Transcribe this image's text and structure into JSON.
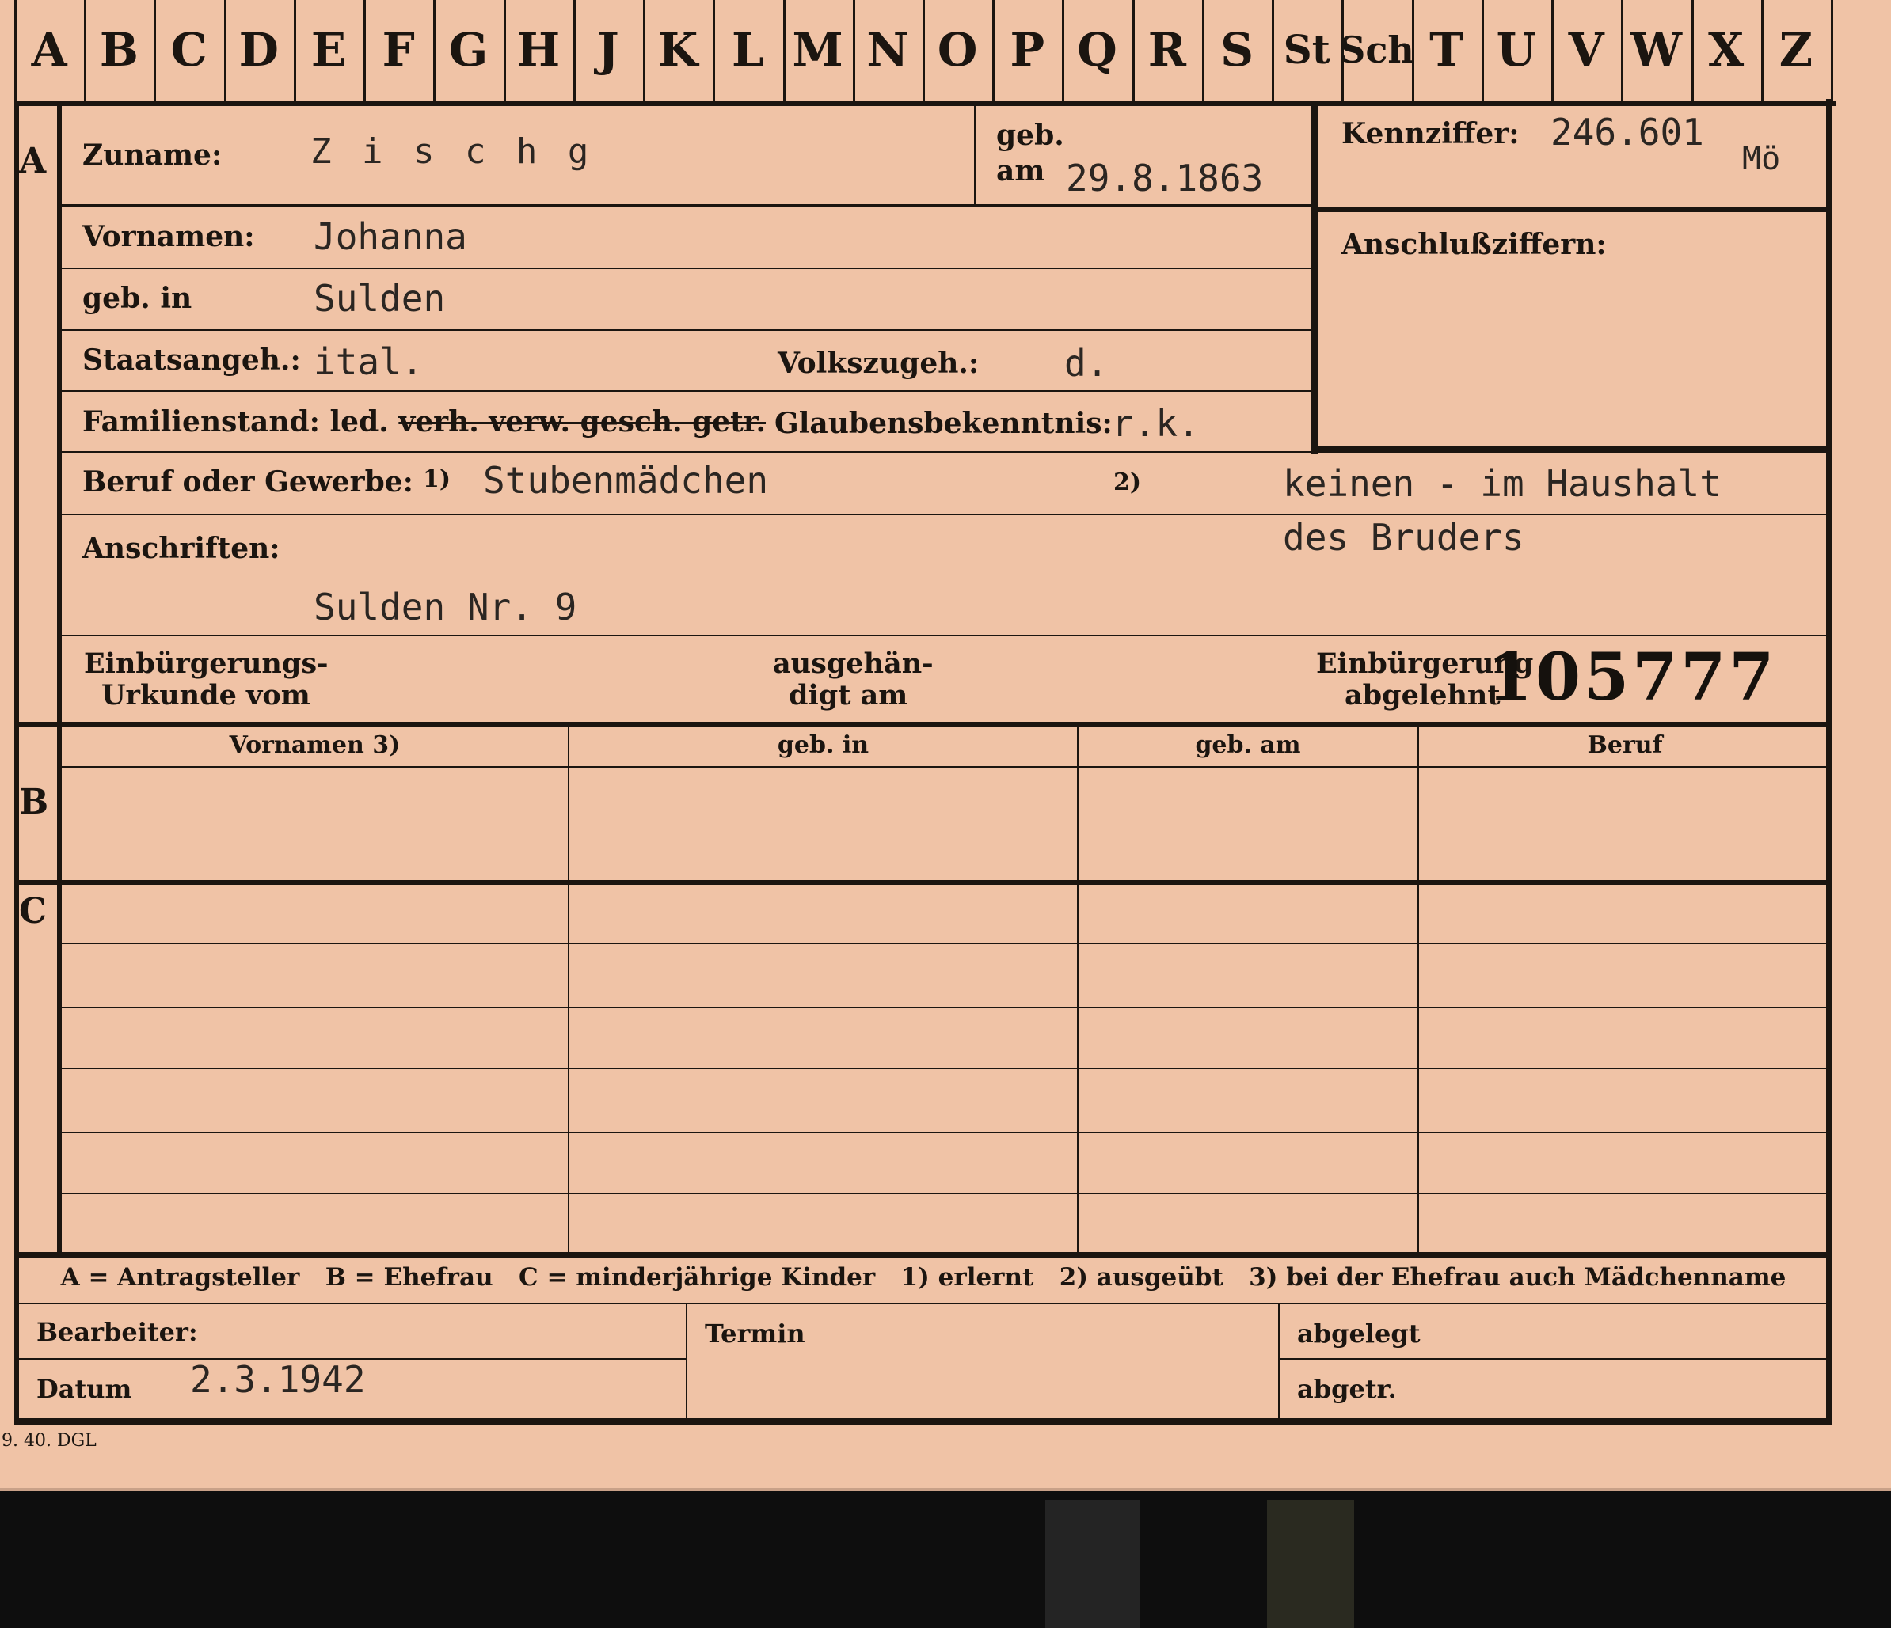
{
  "tabs": [
    "A",
    "B",
    "C",
    "D",
    "E",
    "F",
    "G",
    "H",
    "J",
    "K",
    "L",
    "M",
    "N",
    "O",
    "P",
    "Q",
    "R",
    "S",
    "St",
    "Sch",
    "T",
    "U",
    "V",
    "W",
    "X",
    "Z"
  ],
  "section_marks": {
    "a": "A",
    "b": "B",
    "c": "C"
  },
  "labels": {
    "zuname": "Zuname:",
    "geb_am_1": "geb.",
    "geb_am_2": "am",
    "kennziffer": "Kennziffer:",
    "anschlussziffern": "Anschlußziffern:",
    "vornamen": "Vornamen:",
    "geb_in": "geb. in",
    "staatsangeh": "Staatsangeh.:",
    "volkszugeh": "Volkszugeh.:",
    "familienstand": "Familienstand: led.",
    "familienstand_struck": "verh. verw. gesch. getr.",
    "glaubensbekenntnis": "Glaubensbekenntnis:",
    "beruf": "Beruf oder Gewerbe:",
    "beruf_note1": "1)",
    "beruf_note2": "2)",
    "anschriften": "Anschriften:",
    "einbuergerung_urkunde_1": "Einbürgerungs-",
    "einbuergerung_urkunde_2": "Urkunde vom",
    "ausgehaendigt_1": "ausgehän-",
    "ausgehaendigt_2": "digt am",
    "einbuergerung_abgelehnt_1": "Einbürgerung",
    "einbuergerung_abgelehnt_2": "abgelehnt",
    "footnote": "A = Antragsteller   B = Ehefrau   C = minderjährige Kinder   1) erlernt   2) ausgeübt   3) bei der Ehefrau auch Mädchenname",
    "bearbeiter": "Bearbeiter:",
    "datum": "Datum",
    "termin": "Termin",
    "abgelegt": "abgelegt",
    "abgetr": "abgetr.",
    "print_code": "9. 40. DGL"
  },
  "table_headers": [
    "Vornamen 3)",
    "geb. in",
    "geb. am",
    "Beruf"
  ],
  "values": {
    "zuname": "Z i s c h g",
    "geb_am": "29.8.1863",
    "kennziffer": "246.601",
    "kennziffer_suffix": "Mö",
    "vornamen": "Johanna",
    "geb_in": "Sulden",
    "staatsangeh": "ital.",
    "volkszugeh": "d.",
    "glaubensbekenntnis": "r.k.",
    "beruf_erlernt": "Stubenmädchen",
    "beruf_ausgeuebt_1": "keinen - im Haushalt",
    "beruf_ausgeuebt_2": "des Bruders",
    "anschrift": "Sulden Nr. 9",
    "stamp_number": "105777",
    "datum": "2.3.1942"
  }
}
